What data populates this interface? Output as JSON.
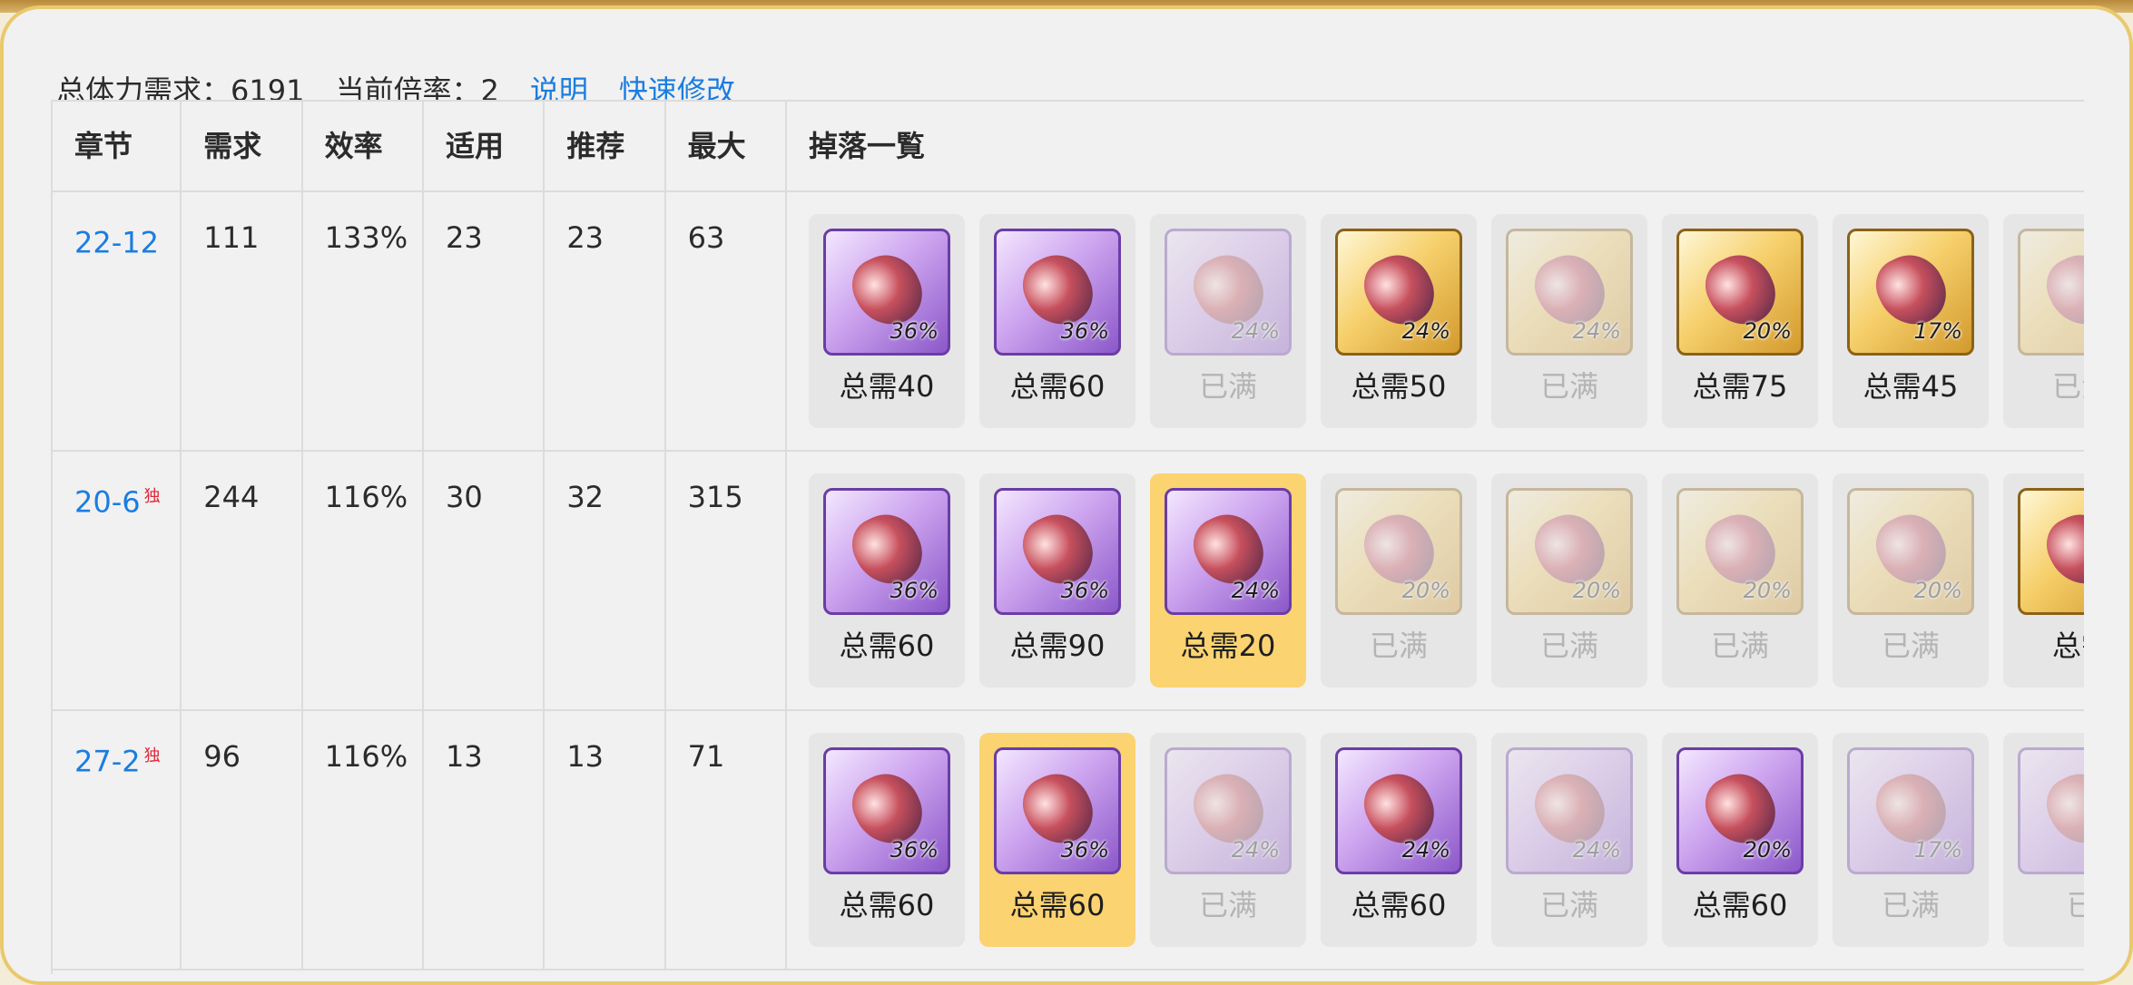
{
  "summary": {
    "total_stamina_label": "总体力需求：6191",
    "rate_label": "当前倍率：2",
    "explain_link": "说明",
    "quick_edit_link": "快速修改"
  },
  "table": {
    "headers": [
      "章节",
      "需求",
      "效率",
      "适用",
      "推荐",
      "最大",
      "掉落一覧"
    ],
    "rows": [
      {
        "stage": "22-12",
        "exclusive": "",
        "demand": "111",
        "efficiency": "133%",
        "applicable": "23",
        "recommended": "23",
        "max": "63",
        "drops": [
          {
            "icon": "sword-icon",
            "rarity": "purple",
            "pct": "36%",
            "label": "总需40",
            "full": false,
            "highlight": false
          },
          {
            "icon": "doll-icon",
            "rarity": "purple",
            "pct": "36%",
            "label": "总需60",
            "full": false,
            "highlight": false
          },
          {
            "icon": "ribbon-icon",
            "rarity": "purple",
            "pct": "24%",
            "label": "已满",
            "full": true,
            "highlight": false
          },
          {
            "icon": "amulet-icon",
            "rarity": "gold",
            "pct": "24%",
            "label": "总需50",
            "full": false,
            "highlight": false
          },
          {
            "icon": "blade-icon",
            "rarity": "gold",
            "pct": "24%",
            "label": "已满",
            "full": true,
            "highlight": false
          },
          {
            "icon": "staff-icon",
            "rarity": "gold",
            "pct": "20%",
            "label": "总需75",
            "full": false,
            "highlight": false
          },
          {
            "icon": "armor-icon",
            "rarity": "gold",
            "pct": "17%",
            "label": "总需45",
            "full": false,
            "highlight": false
          },
          {
            "icon": "boot-icon",
            "rarity": "gold",
            "pct": "",
            "label": "已满",
            "full": true,
            "highlight": false
          }
        ]
      },
      {
        "stage": "20-6",
        "exclusive": "独",
        "demand": "244",
        "efficiency": "116%",
        "applicable": "30",
        "recommended": "32",
        "max": "315",
        "drops": [
          {
            "icon": "bow-icon",
            "rarity": "purple",
            "pct": "36%",
            "label": "总需60",
            "full": false,
            "highlight": false
          },
          {
            "icon": "glove-icon",
            "rarity": "purple",
            "pct": "36%",
            "label": "总需90",
            "full": false,
            "highlight": false
          },
          {
            "icon": "orb-icon",
            "rarity": "purple",
            "pct": "24%",
            "label": "总需20",
            "full": false,
            "highlight": true
          },
          {
            "icon": "necklace-icon",
            "rarity": "gold",
            "pct": "20%",
            "label": "已满",
            "full": true,
            "highlight": false
          },
          {
            "icon": "helmet-icon",
            "rarity": "gold",
            "pct": "20%",
            "label": "已满",
            "full": true,
            "highlight": false
          },
          {
            "icon": "robe-icon",
            "rarity": "gold",
            "pct": "20%",
            "label": "已满",
            "full": true,
            "highlight": false
          },
          {
            "icon": "dagger-icon",
            "rarity": "gold",
            "pct": "20%",
            "label": "已满",
            "full": true,
            "highlight": false
          },
          {
            "icon": "mace-icon",
            "rarity": "gold",
            "pct": "",
            "label": "总需",
            "full": false,
            "highlight": false
          }
        ]
      },
      {
        "stage": "27-2",
        "exclusive": "独",
        "demand": "96",
        "efficiency": "116%",
        "applicable": "13",
        "recommended": "13",
        "max": "71",
        "drops": [
          {
            "icon": "wand-icon",
            "rarity": "purple",
            "pct": "36%",
            "label": "总需60",
            "full": false,
            "highlight": false
          },
          {
            "icon": "axe-icon",
            "rarity": "purple",
            "pct": "36%",
            "label": "总需60",
            "full": false,
            "highlight": true
          },
          {
            "icon": "belt-icon",
            "rarity": "purple",
            "pct": "24%",
            "label": "已满",
            "full": true,
            "highlight": false
          },
          {
            "icon": "scepter-icon",
            "rarity": "purple",
            "pct": "24%",
            "label": "总需60",
            "full": false,
            "highlight": false
          },
          {
            "icon": "scythe-icon",
            "rarity": "purple",
            "pct": "24%",
            "label": "已满",
            "full": true,
            "highlight": false
          },
          {
            "icon": "doll-icon",
            "rarity": "purple",
            "pct": "20%",
            "label": "总需60",
            "full": false,
            "highlight": false
          },
          {
            "icon": "dress-icon",
            "rarity": "purple",
            "pct": "17%",
            "label": "已满",
            "full": true,
            "highlight": false
          },
          {
            "icon": "figure-icon",
            "rarity": "purple",
            "pct": "",
            "label": "已",
            "full": true,
            "highlight": false
          }
        ]
      }
    ]
  }
}
